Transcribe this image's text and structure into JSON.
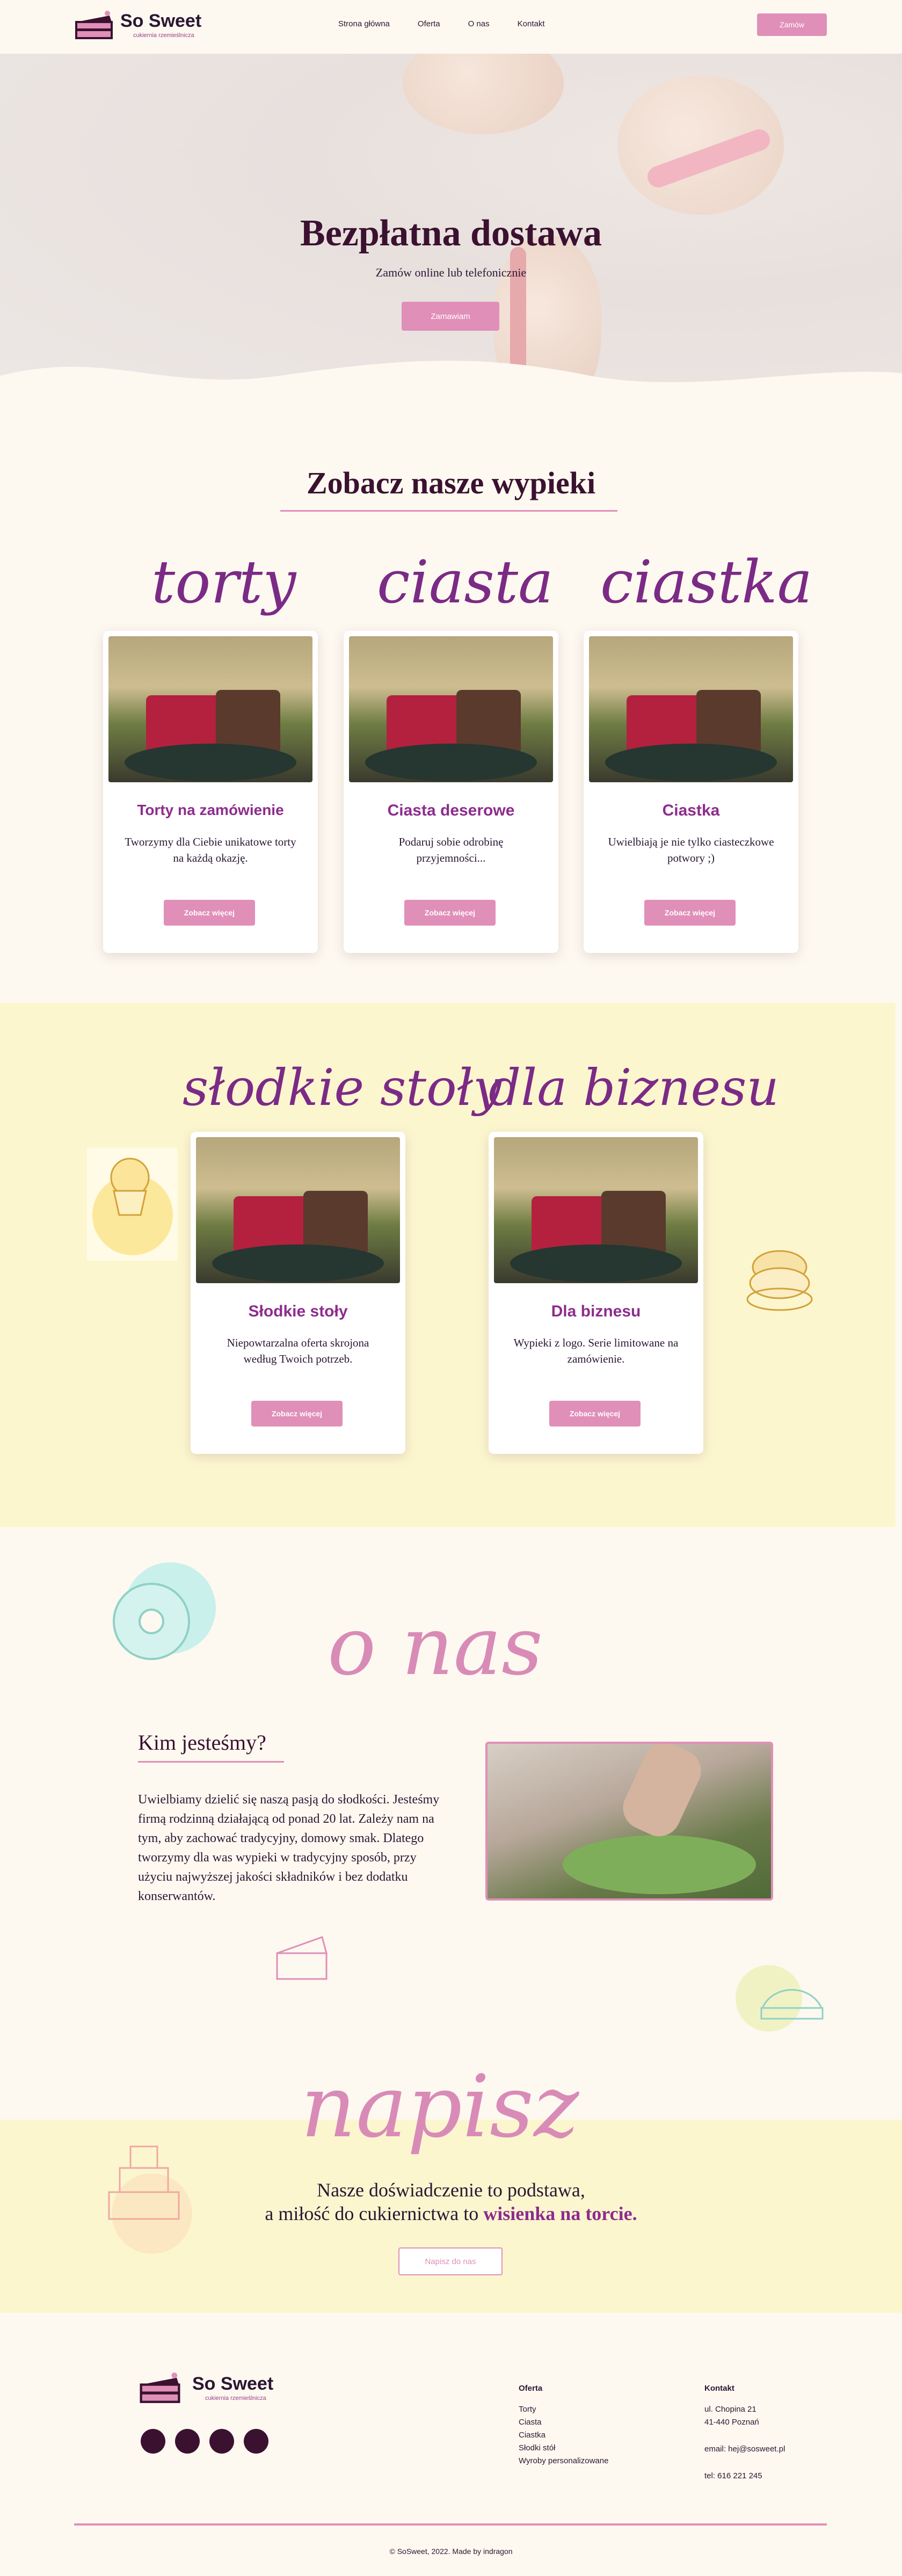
{
  "brand": {
    "name": "So Sweet",
    "tagline": "cukiernia rzemieślnicza"
  },
  "nav": {
    "items": [
      "Strona główna",
      "Oferta",
      "O nas",
      "Kontakt"
    ],
    "order_button": "Zamów"
  },
  "hero": {
    "title": "Bezpłatna dostawa",
    "subtitle": "Zamów online lub telefonicznie",
    "button": "Zamawiam"
  },
  "offer": {
    "title": "Zobacz nasze wypieki",
    "cards": [
      {
        "script": "torty",
        "title": "Torty na zamówienie",
        "desc": "Tworzymy dla Ciebie unikatowe torty na każdą okazję.",
        "button": "Zobacz więcej"
      },
      {
        "script": "ciasta",
        "title": "Ciasta deserowe",
        "desc": "Podaruj sobie odrobinę przyjemności...",
        "button": "Zobacz więcej"
      },
      {
        "script": "ciastka",
        "title": "Ciastka",
        "desc": "Uwielbiają je nie tylko ciasteczkowe potwory ;)",
        "button": "Zobacz więcej"
      },
      {
        "script": "słodkie stoły",
        "title": "Słodkie stoły",
        "desc": "Niepowtarzalna oferta skrojona według Twoich potrzeb.",
        "button": "Zobacz więcej"
      },
      {
        "script": "dla biznesu",
        "title": "Dla biznesu",
        "desc": "Wypieki z logo. Serie limitowane na zamówienie.",
        "button": "Zobacz więcej"
      }
    ]
  },
  "about": {
    "script": "o nas",
    "heading": "Kim jesteśmy?",
    "text": "Uwielbiamy dzielić się naszą pasją do słodkości. Jesteśmy firmą rodzinną działającą od ponad 20 lat. Zależy nam na tym, aby zachować tradycyjny, domowy smak. Dlatego tworzymy dla was wypieki w tradycyjny sposób, przy użyciu najwyższej jakości składników i bez dodatku konserwantów."
  },
  "contact": {
    "script": "napisz",
    "line1": "Nasze doświadczenie to podstawa,",
    "line2_start": "a miłość do cukiernictwa to",
    "line2_highlight": "wisienka na torcie.",
    "button": "Napisz do nas"
  },
  "footer": {
    "offer_heading": "Oferta",
    "offer_links": [
      "Torty",
      "Ciasta",
      "Ciastka",
      "Słodki stół",
      "Wyroby personalizowane"
    ],
    "contact_heading": "Kontakt",
    "address1": "ul. Chopina 21",
    "address2": "41-440 Poznań",
    "email": "email: hej@sosweet.pl",
    "phone": "tel: 616 221 245",
    "copyright": "© SoSweet, 2022. Made by indragon"
  },
  "colors": {
    "accent": "#e08fb8",
    "brand_dark": "#3b1130",
    "script_purple": "#7b2a86",
    "cream": "#fdf9f0",
    "yellow": "#fcf6cf"
  }
}
